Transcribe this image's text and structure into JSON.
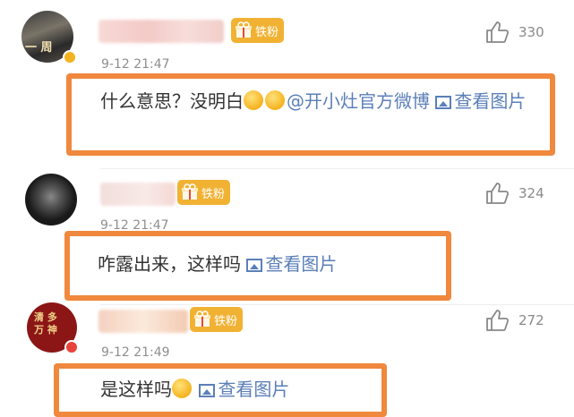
{
  "comments": [
    {
      "timestamp": "9-12 21:47",
      "badge_label": "铁粉",
      "likes": "330",
      "text": "什么意思？没明白",
      "mention": "@开小灶官方微博",
      "view_image": "查看图片",
      "avatar_text": "一 周"
    },
    {
      "timestamp": "9-12 21:47",
      "badge_label": "铁粉",
      "likes": "324",
      "text": "咋露出来，这样吗",
      "view_image": "查看图片"
    },
    {
      "timestamp": "9-12 21:49",
      "badge_label": "铁粉",
      "likes": "272",
      "text": "是这样吗",
      "view_image": "查看图片",
      "avatar_text": "清 多 万 神"
    }
  ],
  "colors": {
    "highlight": "#f0883d",
    "badge": "#f1b233",
    "link": "#5b7fb8",
    "muted": "#8e8e8e"
  },
  "icons": [
    "thumbs-up-icon",
    "image-icon",
    "gift-icon",
    "emoji-icon"
  ]
}
